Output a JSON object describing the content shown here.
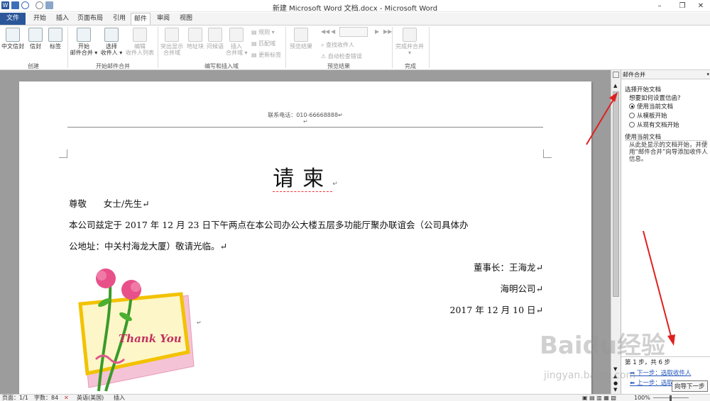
{
  "window": {
    "title": "新建 Microsoft Word 文档.docx - Microsoft Word",
    "controls": [
      "–",
      "❐",
      "✕"
    ]
  },
  "quick_access": [
    "W",
    "save",
    "undo",
    "redo",
    "print"
  ],
  "tabs": [
    "文件",
    "开始",
    "插入",
    "页面布局",
    "引用",
    "邮件",
    "审阅",
    "视图"
  ],
  "active_tab": "邮件",
  "ribbon": {
    "groups": [
      "创建",
      "开始邮件合并",
      "编写和插入域",
      "预览结果",
      "完成"
    ],
    "create": [
      {
        "label": "中文信封"
      },
      {
        "label": "信封"
      },
      {
        "label": "标签"
      }
    ],
    "start_merge": [
      {
        "label": "开始\n邮件合并 ▾"
      },
      {
        "label": "选择\n收件人 ▾"
      },
      {
        "label": "编辑\n收件人列表"
      }
    ],
    "write_insert": [
      {
        "label": "突出显示\n合并域"
      },
      {
        "label": "地址块"
      },
      {
        "label": "问候语"
      },
      {
        "label": "插入\n合并域 ▾"
      }
    ],
    "rules": [
      "规则 ▾",
      "匹配域",
      "更新标签"
    ],
    "preview": [
      {
        "label": "预览结果"
      }
    ],
    "preview_small": [
      "查找收件人",
      "自动检查错误"
    ],
    "nav_arrows": [
      "◀◀",
      "◀",
      "▶",
      "▶▶"
    ],
    "finish": [
      {
        "label": "完成并合并\n▾"
      }
    ]
  },
  "document": {
    "header_contact": "联系电话：010-66668888↵",
    "header_mark": "↵",
    "title": "请柬",
    "title_mark": "↵",
    "salutation": "尊敬      女士/先生↵",
    "body_line1": "本公司兹定于 2017 年 12 月 23 日下午两点在本公司办公大楼五层多功能厅聚办联谊会（公司具体办",
    "body_line2": "公地址：中关村海龙大厦）敬请光临。↵",
    "signer": "董事长：王海龙↵",
    "company": "海明公司↵",
    "date": "2017 年 12 月 10 日↵",
    "card_text": "Thank You",
    "card_mark": "↵"
  },
  "task_pane": {
    "title": "邮件合并",
    "section1": "选择开始文档",
    "question": "想要如何设置信函?",
    "options": [
      {
        "label": "使用当前文档",
        "checked": true
      },
      {
        "label": "从模板开始",
        "checked": false
      },
      {
        "label": "从现有文档开始",
        "checked": false
      }
    ],
    "section2": "使用当前文档",
    "description": "从此处显示的文档开始，并使用“邮件合并”向导添加收件人信息。",
    "step_label": "第 1 步，共 6 步",
    "next": "下一步：选取收件人",
    "prev": "上一步：选取",
    "tooltip": "向导下一步"
  },
  "status_bar": {
    "page": "页面：1/1",
    "words": "字数：84",
    "language": "英语(美国)",
    "mode": "插入",
    "zoom": "100%"
  },
  "watermark": {
    "brand": "Baidu经验",
    "url": "jingyan.baidu.com"
  },
  "colors": {
    "accent": "#2b579a",
    "arrow": "#e02020",
    "link": "#2255bb"
  }
}
